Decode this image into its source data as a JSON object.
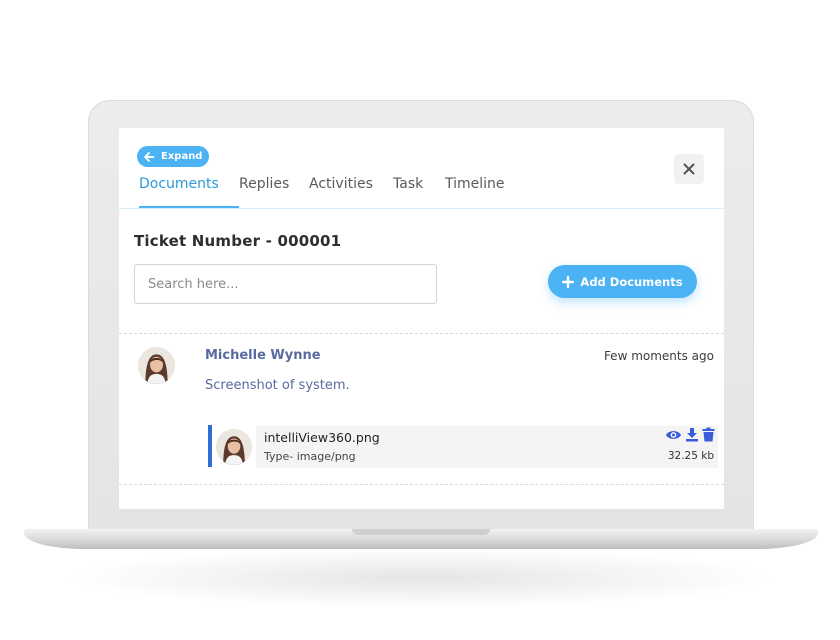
{
  "colors": {
    "accent": "#4bb3f4",
    "tab_active": "#2d9ad8",
    "author": "#5a6aa0",
    "file_accent": "#2f6fd6",
    "action_icons": "#3b5bdb"
  },
  "header": {
    "expand_label": "Expand",
    "expand_icon": "arrow-left-icon",
    "close_icon": "close-icon"
  },
  "tabs": [
    {
      "label": "Documents",
      "active": true
    },
    {
      "label": "Replies",
      "active": false
    },
    {
      "label": "Activities",
      "active": false
    },
    {
      "label": "Task",
      "active": false
    },
    {
      "label": "Timeline",
      "active": false
    }
  ],
  "ticket": {
    "title": "Ticket Number - 000001"
  },
  "search": {
    "placeholder": "Search here..."
  },
  "actions": {
    "add_label": "Add Documents",
    "add_icon": "plus-icon"
  },
  "entry": {
    "author": "Michelle Wynne",
    "time": "Few moments ago",
    "message": "Screenshot of system.",
    "file": {
      "name": "intelliView360.png",
      "type": "Type- image/png",
      "size": "32.25 kb",
      "icons": [
        "eye-icon",
        "download-icon",
        "trash-icon"
      ]
    }
  }
}
